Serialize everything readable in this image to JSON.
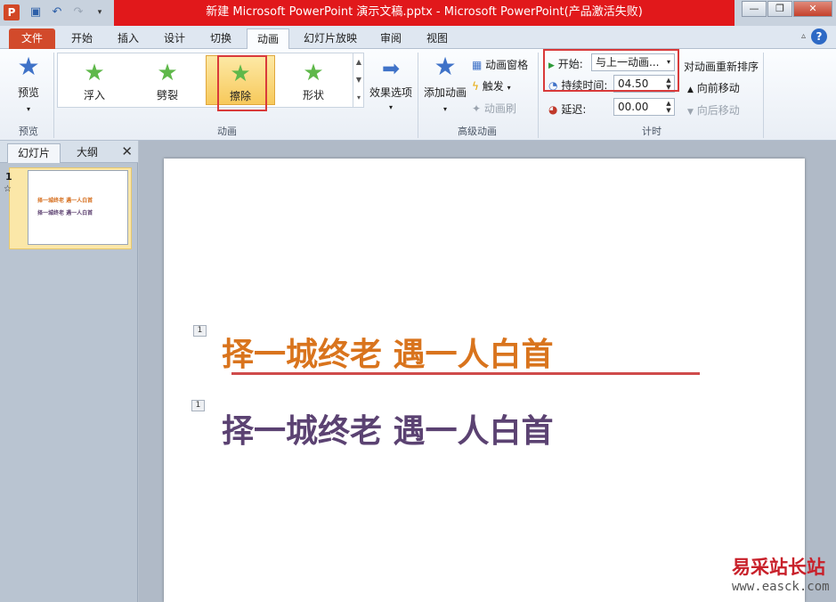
{
  "window": {
    "title": "新建 Microsoft PowerPoint 演示文稿.pptx - Microsoft PowerPoint(产品激活失败)",
    "app_icon": "P",
    "buttons": [
      "—",
      "❐",
      "✕"
    ]
  },
  "tabs": [
    "文件",
    "开始",
    "插入",
    "设计",
    "切换",
    "动画",
    "幻灯片放映",
    "审阅",
    "视图"
  ],
  "ribbon": {
    "preview": {
      "label": "预览",
      "group": "预览"
    },
    "animation_group": "动画",
    "gallery": [
      "浮入",
      "劈裂",
      "擦除",
      "形状"
    ],
    "selected_effect": "擦除",
    "effect_options": "效果选项",
    "advanced": {
      "group": "高级动画",
      "add_animation": "添加动画",
      "animation_pane": "动画窗格",
      "trigger": "触发",
      "painter": "动画刷"
    },
    "timing": {
      "group": "计时",
      "start_label": "开始:",
      "start_value": "与上一动画...",
      "duration_label": "持续时间:",
      "duration_value": "04.50",
      "delay_label": "延迟:",
      "delay_value": "00.00",
      "reorder_title": "对动画重新排序",
      "move_earlier": "向前移动",
      "move_later": "向后移动"
    }
  },
  "left_pane": {
    "tabs": [
      "幻灯片",
      "大纲"
    ],
    "close": "✕",
    "slide_number": "1",
    "thumb_line1": "择一城终老  遇一人白首",
    "thumb_line2": "择一城终老  遇一人白首"
  },
  "slide": {
    "line1": "择一城终老   遇一人白首",
    "line2": "择一城终老   遇一人白首",
    "tag1": "1",
    "tag2": "1"
  },
  "watermark": {
    "name": "易采站长站",
    "url": "www.easck.com"
  }
}
